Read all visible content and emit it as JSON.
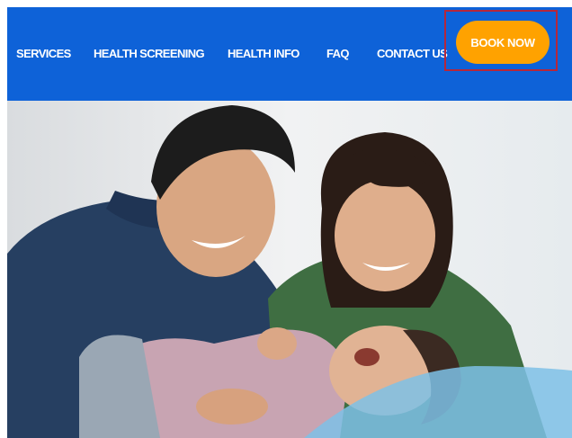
{
  "nav": {
    "items": [
      {
        "label": "SERVICES"
      },
      {
        "label": "HEALTH SCREENING"
      },
      {
        "label": "HEALTH INFO"
      },
      {
        "label": "FAQ"
      },
      {
        "label": "CONTACT US"
      }
    ],
    "book_label": "BOOK NOW"
  },
  "colors": {
    "nav_background": "#0e62d8",
    "book_button": "#ffa200",
    "highlight_border": "#b5273b"
  },
  "hero": {
    "image": "family-laughing-photo"
  }
}
